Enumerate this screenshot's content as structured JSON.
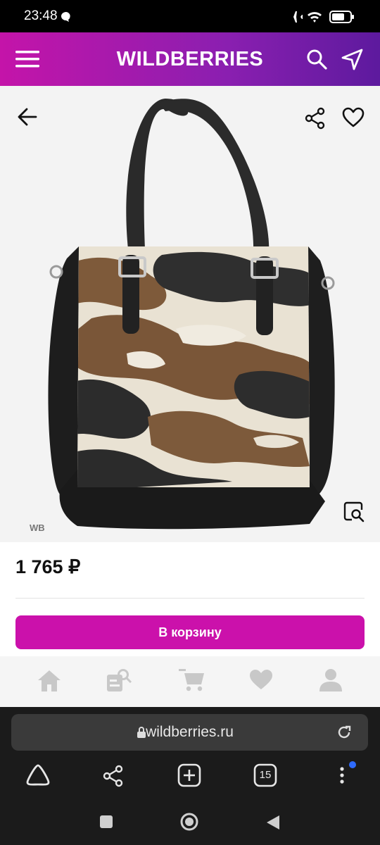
{
  "status_bar": {
    "time": "23:48"
  },
  "header": {
    "title": "WILDBERRIES"
  },
  "product": {
    "watermark": "WB",
    "price": "1 765 ₽"
  },
  "cart_button": {
    "label": "В корзину"
  },
  "browser": {
    "url": "wildberries.ru",
    "tabs_count": "15"
  },
  "colors": {
    "brand": "#cb11ab",
    "header_gradient_start": "#c414a9",
    "header_gradient_end": "#5d1a9e"
  }
}
